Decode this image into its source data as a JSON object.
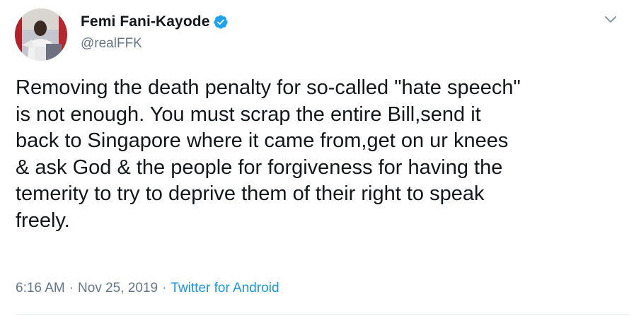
{
  "author": {
    "name": "Femi Fani-Kayode",
    "handle": "@realFFK",
    "verified": true
  },
  "tweet": {
    "text": "Removing the death penalty for so-called \"hate speech\"\nis not enough. You must scrap the entire Bill,send it\nback to Singapore where it came from,get on ur knees\n& ask God & the people for forgiveness for having the\ntemerity to try to deprive them of their right to speak\nfreely.",
    "time": "6:16 AM",
    "separator": "·",
    "date": "Nov 25, 2019",
    "source": "Twitter for Android"
  },
  "icons": {
    "verified": "verified-badge-icon",
    "menu": "chevron-down-icon"
  },
  "colors": {
    "text": "#14171a",
    "secondary": "#657786",
    "link": "#1b95e0",
    "verified": "#1da1f2"
  }
}
